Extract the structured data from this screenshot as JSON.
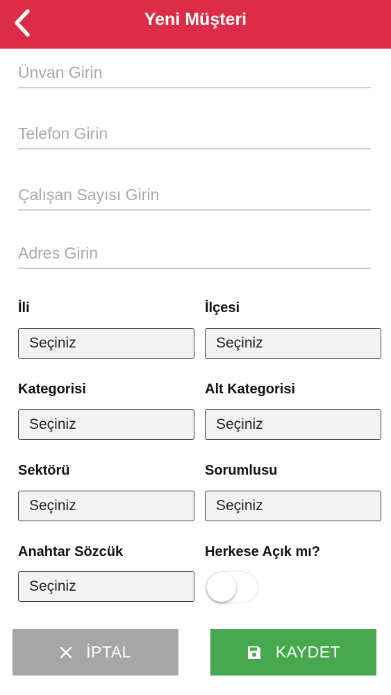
{
  "header": {
    "title": "Yeni Müşteri",
    "back_icon": "chevron-left-icon",
    "background": "#dd2c45"
  },
  "fields": {
    "unvan_placeholder": "Ünvan Girin",
    "telefon_placeholder": "Telefon Girin",
    "calisan_placeholder": "Çalışan Sayısı Girin",
    "adres_placeholder": "Adres Girin"
  },
  "selects": {
    "il": {
      "label": "İli",
      "value": "Seçiniz"
    },
    "ilce": {
      "label": "İlçesi",
      "value": "Seçiniz"
    },
    "kategori": {
      "label": "Kategorisi",
      "value": "Seçiniz"
    },
    "alt_kategori": {
      "label": "Alt Kategorisi",
      "value": "Seçiniz"
    },
    "sektor": {
      "label": "Sektörü",
      "value": "Seçiniz"
    },
    "sorumlu": {
      "label": "Sorumlusu",
      "value": "Seçiniz"
    },
    "anahtar": {
      "label": "Anahtar Sözcük",
      "value": "Seçiniz"
    }
  },
  "public_toggle": {
    "label": "Herkese Açık mı?",
    "on": false
  },
  "buttons": {
    "cancel_label": "İPTAL",
    "cancel_icon": "close-icon",
    "cancel_color": "#a6a6a6",
    "save_label": "KAYDET",
    "save_icon": "floppy-disk-icon",
    "save_color": "#47a94e"
  }
}
